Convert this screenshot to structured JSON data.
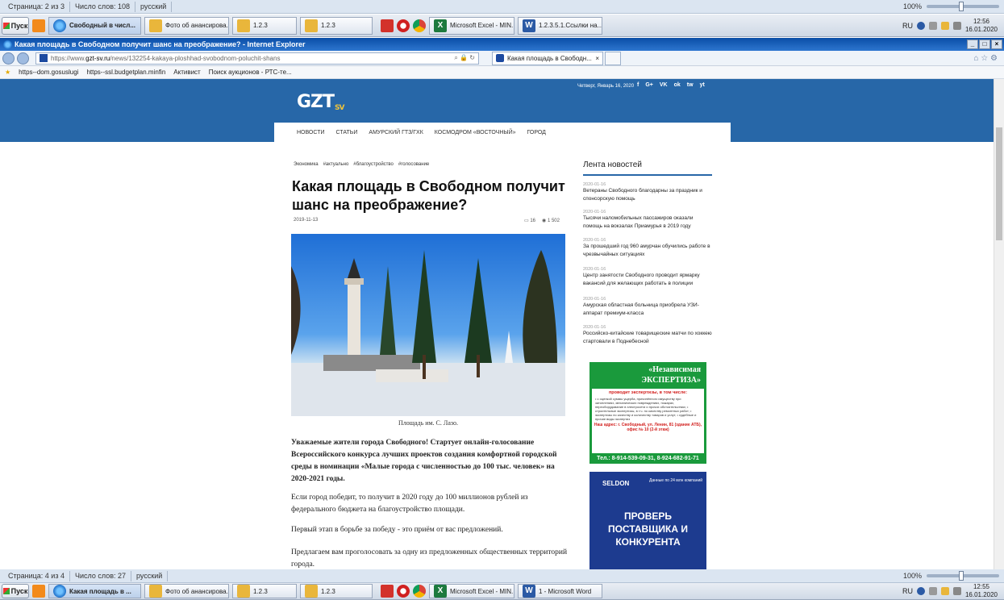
{
  "word_status_top": {
    "page": "Страница: 2 из 3",
    "words": "Число слов: 108",
    "lang": "русский",
    "zoom": "100%"
  },
  "word_status_bottom": {
    "page": "Страница: 4 из 4",
    "words": "Число слов: 27",
    "lang": "русский",
    "zoom": "100%"
  },
  "taskbar_top": {
    "start": "Пуск",
    "items": [
      "Свободный в числ...",
      "Фото об анансирова...",
      "1.2.3",
      "1.2.3",
      "Microsoft Excel - MIN...",
      "1.2.3.5.1.Ссылки на..."
    ],
    "tray_lang": "RU",
    "time": "12:56",
    "date": "16.01.2020"
  },
  "taskbar_bottom": {
    "start": "Пуск",
    "items": [
      "Какая площадь в ...",
      "Фото об анансирова...",
      "1.2.3",
      "1.2.3",
      "Microsoft Excel - MIN...",
      "1 - Microsoft Word"
    ],
    "tray_lang": "RU",
    "time": "12:55",
    "date": "16.01.2020"
  },
  "ie": {
    "title": "Какая площадь в Свободном получит шанс на преображение? - Internet Explorer",
    "address_scheme": "https://www.",
    "address_domain": "gzt-sv.ru",
    "address_path": "/news/132254-kakaya-ploshhad-svobodnom-poluchit-shans",
    "tab_label": "Какая площадь в Свободн...",
    "favorites": [
      "https--dom.gosuslugi",
      "https--ssl.budgetplan.minfin",
      "Активист",
      "Поиск аукционов - РТС-те..."
    ]
  },
  "site": {
    "logo": "GZT",
    "logo_sub": "SV",
    "date": "Четверг, Январь 16, 2020",
    "social": [
      "f",
      "G+",
      "VK",
      "ok",
      "tw",
      "yt"
    ],
    "menu": [
      "НОВОСТИ",
      "СТАТЬИ",
      "АМУРСКИЙ ГТЗ/ГХК",
      "КОСМОДРОМ «ВОСТОЧНЫЙ»",
      "ГОРОД"
    ]
  },
  "article": {
    "tags": [
      "Экономика",
      "#актуально",
      "#благоустройство",
      "#голосование"
    ],
    "title": "Какая площадь в Свободном получит шанс на преображение?",
    "date": "2019-11-13",
    "comments": "16",
    "views": "1 502",
    "caption": "Площадь им. С. Лазо.",
    "lead": "Уважаемые жители города Свободного! Стартует онлайн-голосование Всероссийского конкурса лучших проектов создания комфортной городской среды в номинации «Малые города с численностью до 100 тыс. человек» на 2020-2021 годы.",
    "p1": "Если город победит, то получит в 2020 году до 100 миллионов рублей из федерального бюджета на благоустройство площади.",
    "p2": "Первый этап в борьбе за победу - это приём от вас предложений.",
    "p3": "Предлагаем вам проголосовать за одну из предложенных общественных территорий города."
  },
  "sidebar": {
    "title": "Лента новостей",
    "news": [
      {
        "date": "2020-01-16",
        "text": "Ветераны Свободного благодарны за праздник и спонсорскую помощь"
      },
      {
        "date": "2020-01-16",
        "text": "Тысячи наломобильных пассажиров оказали помощь на вокзалах Приамурья в 2019 году"
      },
      {
        "date": "2020-01-16",
        "text": "За прошедший год 960 амурчан обучились работе в чрезвычайных ситуациях"
      },
      {
        "date": "2020-01-16",
        "text": "Центр занятости Свободного проводит ярмарку вакансий для желающих работать в полиции"
      },
      {
        "date": "2020-01-16",
        "text": "Амурская областная больница приобрела УЗИ-аппарат премиум-класса"
      },
      {
        "date": "2020-01-16",
        "text": "Российско-китайские товарищеские матчи по хоккею стартовали в Поднебесной"
      }
    ]
  },
  "ad1": {
    "line1": "«Независимая",
    "line2": "ЭКСПЕРТИЗА»",
    "sub": "проводит экспертизы, в том числе:",
    "lines": "• с оценкой суммы ущерба, причинённого имуществу при затоплениях, механических повреждениях, пожарах, переоборудование в электросети и прочих обстоятельствах; • строительные экспертизы, в т.ч. по качеству ремонтных работ; • экспертизы по качеству и количеству товаров и услуг; • судебные и прочие виды экспертиз",
    "address": "Наш адрес: г. Свободный, ул. Ленин, 81 (здание АТБ), офис № 10 (2-й этаж)",
    "phone": "Тел.: 8-914-539-09-31, 8-924-682-91-71"
  },
  "ad2": {
    "brand": "SELDON",
    "tag": "Данные по 24 млн компаний",
    "big": "ПРОВЕРЬ ПОСТАВЩИКА И КОНКУРЕНТА"
  }
}
